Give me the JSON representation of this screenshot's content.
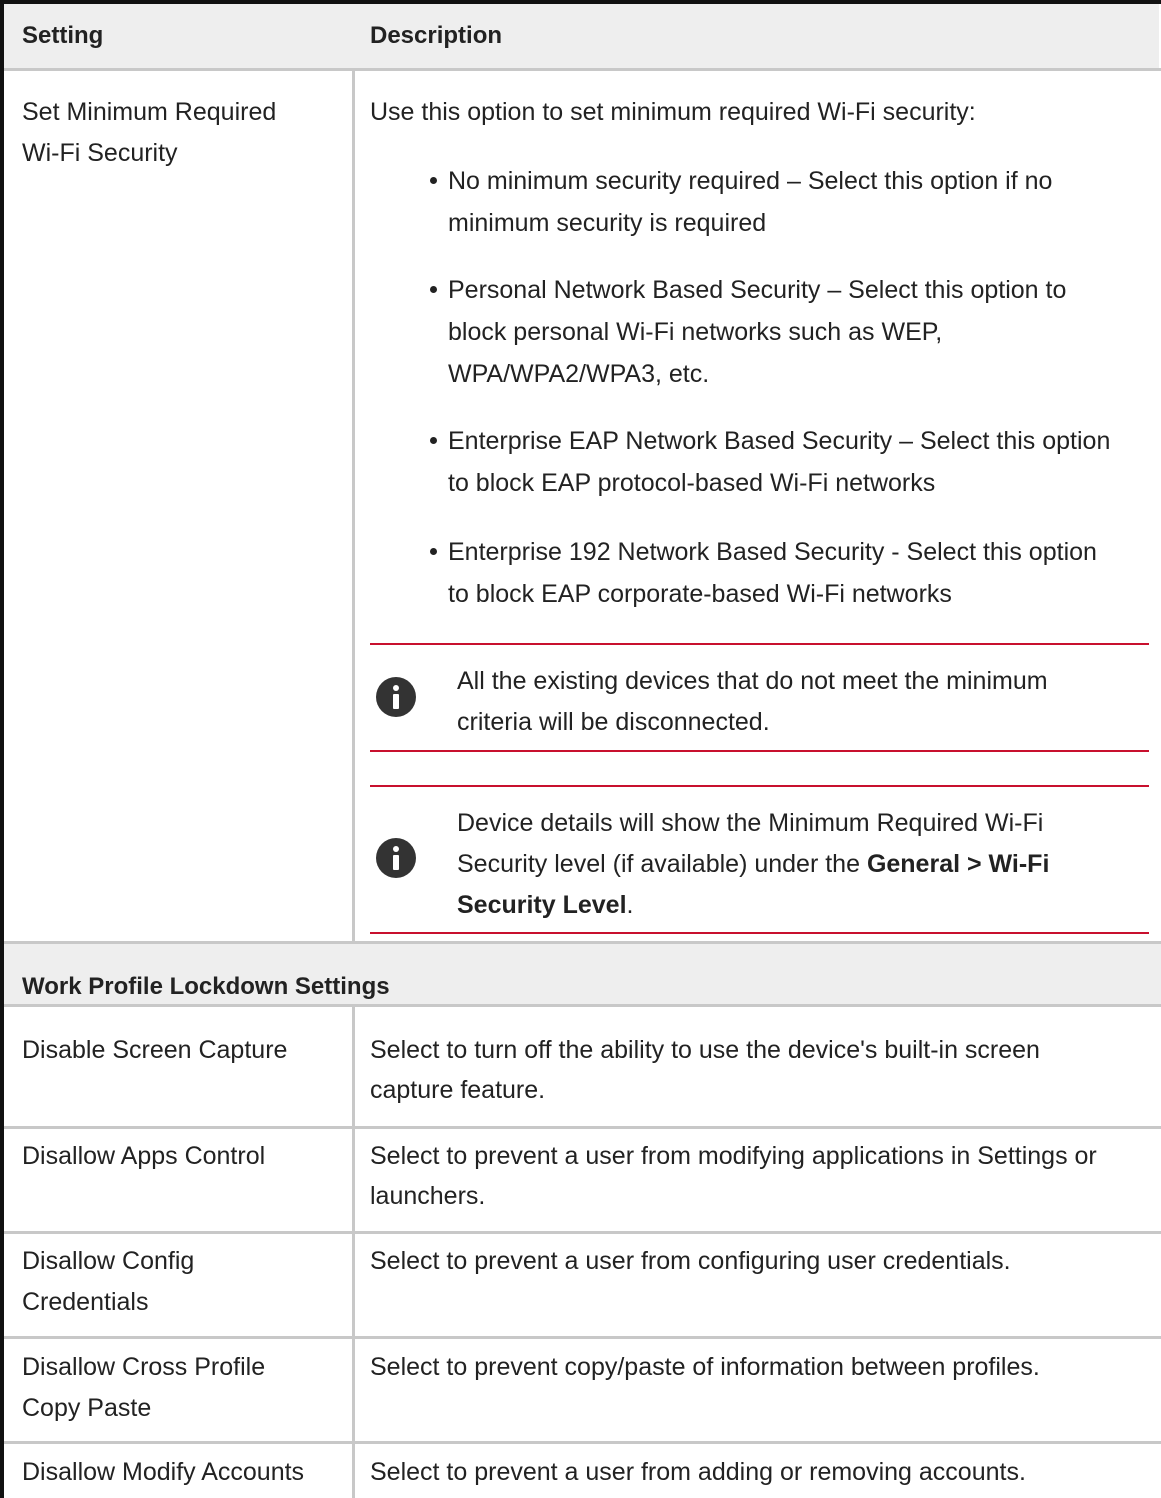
{
  "table": {
    "headers": {
      "setting": "Setting",
      "description": "Description"
    },
    "wifi": {
      "setting_line1": "Set Minimum Required",
      "setting_line2": "Wi-Fi Security",
      "intro": "Use this option to set minimum required Wi-Fi security:",
      "options": [
        {
          "line1": "No minimum security required – Select this option if no",
          "line2": "minimum security is required",
          "line3": ""
        },
        {
          "line1": "Personal Network Based Security – Select this option to",
          "line2": "block personal Wi-Fi networks such as WEP,",
          "line3": "WPA/WPA2/WPA3, etc."
        },
        {
          "line1": "Enterprise EAP Network Based Security – Select this option",
          "line2": "to block EAP protocol-based Wi-Fi networks",
          "line3": ""
        },
        {
          "line1": "Enterprise 192 Network Based Security - Select this option",
          "line2": "to block EAP corporate-based Wi-Fi networks",
          "line3": ""
        }
      ],
      "note1": {
        "line1": "All the existing devices that do not meet the minimum",
        "line2": "criteria will be disconnected."
      },
      "note2": {
        "line1": "Device details will show the Minimum Required Wi-Fi",
        "line2_prefix": "Security level (if available) under the ",
        "line2_bold": "General  >  Wi-Fi",
        "line3_bold": "Security Level",
        "line3_suffix": "."
      },
      "icon": "info-icon"
    },
    "section_title": "Work Profile Lockdown Settings",
    "rows": [
      {
        "setting_line1": "Disable Screen Capture",
        "setting_line2": "",
        "desc_line1": "Select to turn off the ability to use the device's built-in screen",
        "desc_line2": "capture feature."
      },
      {
        "setting_line1": "Disallow Apps Control",
        "setting_line2": "",
        "desc_line1": "Select to prevent a user from modifying applications in Settings or",
        "desc_line2": "launchers."
      },
      {
        "setting_line1": "Disallow Config",
        "setting_line2": "Credentials",
        "desc_line1": "Select to prevent a user from configuring user credentials.",
        "desc_line2": ""
      },
      {
        "setting_line1": "Disallow Cross Profile",
        "setting_line2": "Copy Paste",
        "desc_line1": "Select to prevent copy/paste of information between profiles.",
        "desc_line2": ""
      },
      {
        "setting_line1": "Disallow Modify Accounts",
        "setting_line2": "",
        "desc_line1": "Select to prevent a user from adding or removing accounts.",
        "desc_line2": ""
      }
    ],
    "colors": {
      "header_bg": "#eeeeee",
      "grid": "#c8c8c8",
      "note_rule": "#c8102e",
      "left_edge": "#111111"
    }
  }
}
